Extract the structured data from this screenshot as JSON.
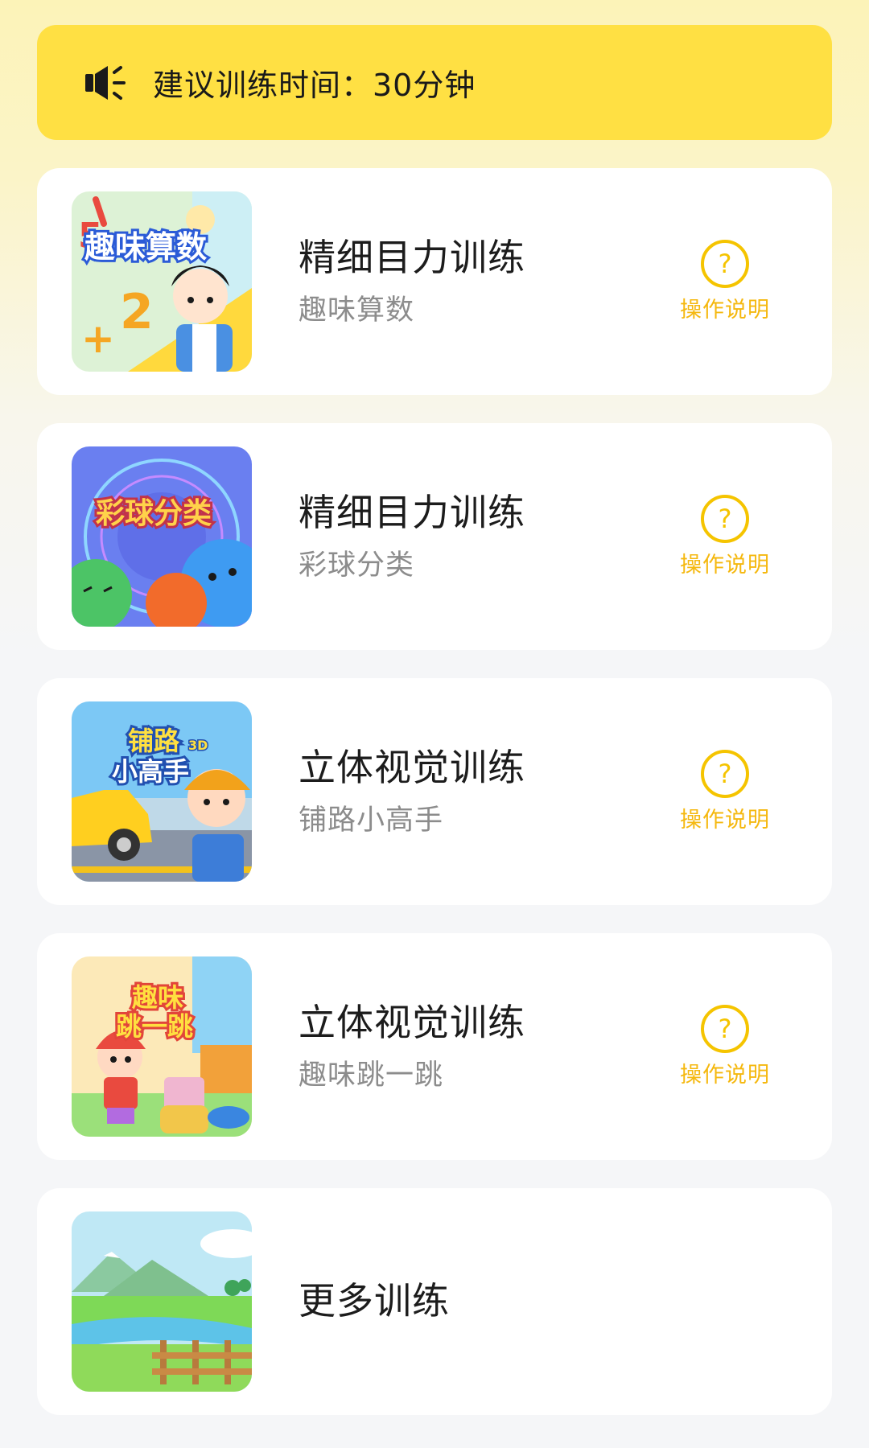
{
  "banner": {
    "icon": "speaker-icon",
    "text": "建议训练时间：30分钟",
    "background_color": "#FFE043"
  },
  "accent_color": "#F5B80F",
  "cards": [
    {
      "title": "精细目力训练",
      "subtitle": "趣味算数",
      "thumb_text": "趣味算数",
      "help_label": "操作说明",
      "help_icon": "question-circle-icon"
    },
    {
      "title": "精细目力训练",
      "subtitle": "彩球分类",
      "thumb_text": "彩球分类",
      "help_label": "操作说明",
      "help_icon": "question-circle-icon"
    },
    {
      "title": "立体视觉训练",
      "subtitle": "铺路小高手",
      "thumb_text_1": "铺路",
      "thumb_text_2": "小高手",
      "thumb_badge": "3D",
      "help_label": "操作说明",
      "help_icon": "question-circle-icon"
    },
    {
      "title": "立体视觉训练",
      "subtitle": "趣味跳一跳",
      "thumb_text_1": "趣味",
      "thumb_text_2": "跳一跳",
      "help_label": "操作说明",
      "help_icon": "question-circle-icon"
    },
    {
      "title": "更多训练"
    }
  ]
}
